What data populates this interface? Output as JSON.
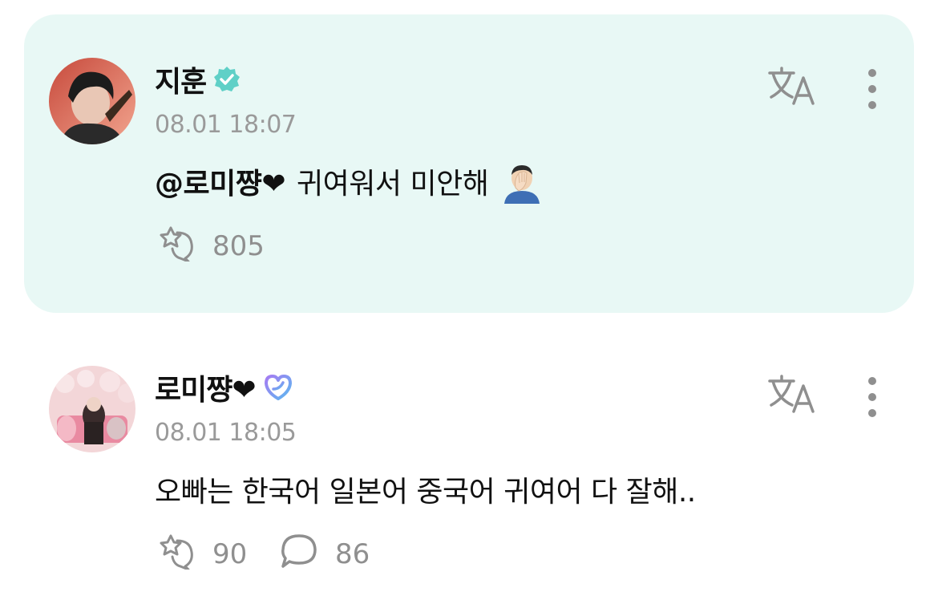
{
  "reply": {
    "author": "지훈",
    "verified_icon": "verified-badge-icon",
    "timestamp": "08.01 18:07",
    "mention": "@로미쨩❤",
    "text": "귀여워서 미안해",
    "emoji": "facepalm-emoji",
    "likes": "805",
    "background_color": "#e8f8f5"
  },
  "comment": {
    "author": "로미쨩❤",
    "membership_icon": "membership-badge-icon",
    "timestamp": "08.01 18:05",
    "text": "오빠는 한국어 일본어 중국어 귀여어 다 잘해..",
    "likes": "90",
    "replies": "86"
  },
  "colors": {
    "accent": "#5fd0c7",
    "icon_gray": "#8f8f8f",
    "timestamp_gray": "#9a9a9a"
  }
}
